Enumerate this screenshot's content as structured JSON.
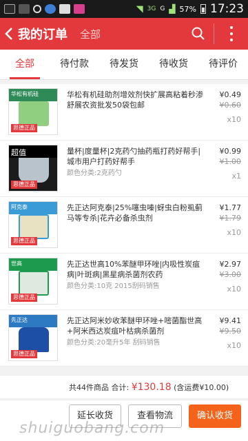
{
  "status_bar": {
    "battery": "57%",
    "time": "17:23",
    "network": "3G",
    "carrier_icon": "G"
  },
  "header": {
    "title": "我的订单",
    "filter": "全部"
  },
  "tabs": [
    {
      "label": "全部"
    },
    {
      "label": "待付款"
    },
    {
      "label": "待发货"
    },
    {
      "label": "待收货"
    },
    {
      "label": "待评价"
    }
  ],
  "items": [
    {
      "thumb_title": "华松有机硅",
      "title": "华松有机硅助剂增效剂快扩展高粘着秒渗舒展农资批发50袋包邮",
      "spec": "",
      "price": "¥0.49",
      "old_price": "¥0.60",
      "qty": "x10",
      "thumb_badge": "思德正品"
    },
    {
      "thumb_title": "超值",
      "title": "量杯|度量杯|2克药勺抽药瓶打药好帮手|城市用户打药好帮手",
      "spec": "颜色分类:2克药勺",
      "price": "¥0.99",
      "old_price": "¥1.00",
      "qty": "x1",
      "thumb_badge": "思德正品"
    },
    {
      "thumb_title": "阿克泰",
      "title": "先正达阿克泰|25%噻虫嗪|蚜虫白粉虱蓟马等专杀|花卉必备杀虫剂",
      "spec": "",
      "price": "¥1.77",
      "old_price": "¥1.79",
      "qty": "x10",
      "thumb_badge": "思德正品"
    },
    {
      "thumb_title": "世高",
      "title": "先正达世高10%苯醚甲环唑|内吸性炭疽病|叶斑病|黑星病杀菌剂农药",
      "spec": "颜色分类:10克  2015刮码销售",
      "price": "¥2.97",
      "old_price": "¥3.00",
      "qty": "x10",
      "thumb_badge": "思德正品"
    },
    {
      "thumb_title": "先正达",
      "title": "先正达阿米妙收苯醚甲环唑+嘧菌酯世高+阿米西达炭疽叶枯病杀菌剂",
      "spec": "颜色分类:20毫升5年 刮码销售",
      "price": "¥9.41",
      "old_price": "¥9.50",
      "qty": "x10",
      "thumb_badge": "思德正品"
    }
  ],
  "summary": {
    "count_text": "共44件商品  合计:",
    "amount": "¥130.18",
    "shipping": "(含运费¥10.00)"
  },
  "actions": {
    "extend": "延长收货",
    "track": "查看物流",
    "confirm": "确认收货"
  },
  "watermark": "shuiguobang.com",
  "colors": {
    "brand_red": "#e4393c",
    "confirm_orange": "#f5621a"
  }
}
